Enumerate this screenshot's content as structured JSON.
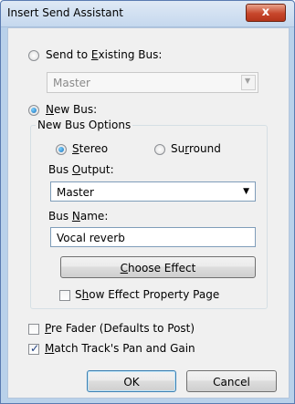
{
  "window": {
    "title": "Insert Send Assistant",
    "close_label": "x"
  },
  "existing_bus": {
    "label_before": "Send to ",
    "label_key": "E",
    "label_after": "xisting Bus:",
    "combo_value": "Master"
  },
  "new_bus": {
    "label_key": "N",
    "label_after": "ew Bus:",
    "options_title": "New Bus Options"
  },
  "stereo": {
    "label_key": "S",
    "label_after": "tereo"
  },
  "surround": {
    "label_before": "Su",
    "label_key": "r",
    "label_after": "round"
  },
  "bus_output": {
    "label_before": "Bus ",
    "label_key": "O",
    "label_after": "utput:",
    "value": "Master"
  },
  "bus_name": {
    "label_before": "Bus ",
    "label_key": "N",
    "label_after": "ame:",
    "value": "Vocal reverb"
  },
  "choose_effect": {
    "label_key": "C",
    "label_after": "hoose Effect"
  },
  "show_effect": {
    "label_before": "S",
    "label_key": "h",
    "label_after": "ow Effect Property Page"
  },
  "pre_fader": {
    "label_key": "P",
    "label_after": "re Fader (Defaults to Post)"
  },
  "match_track": {
    "label_key": "M",
    "label_after": "atch Track's Pan and Gain"
  },
  "ok_label": "OK",
  "cancel_label": "Cancel"
}
